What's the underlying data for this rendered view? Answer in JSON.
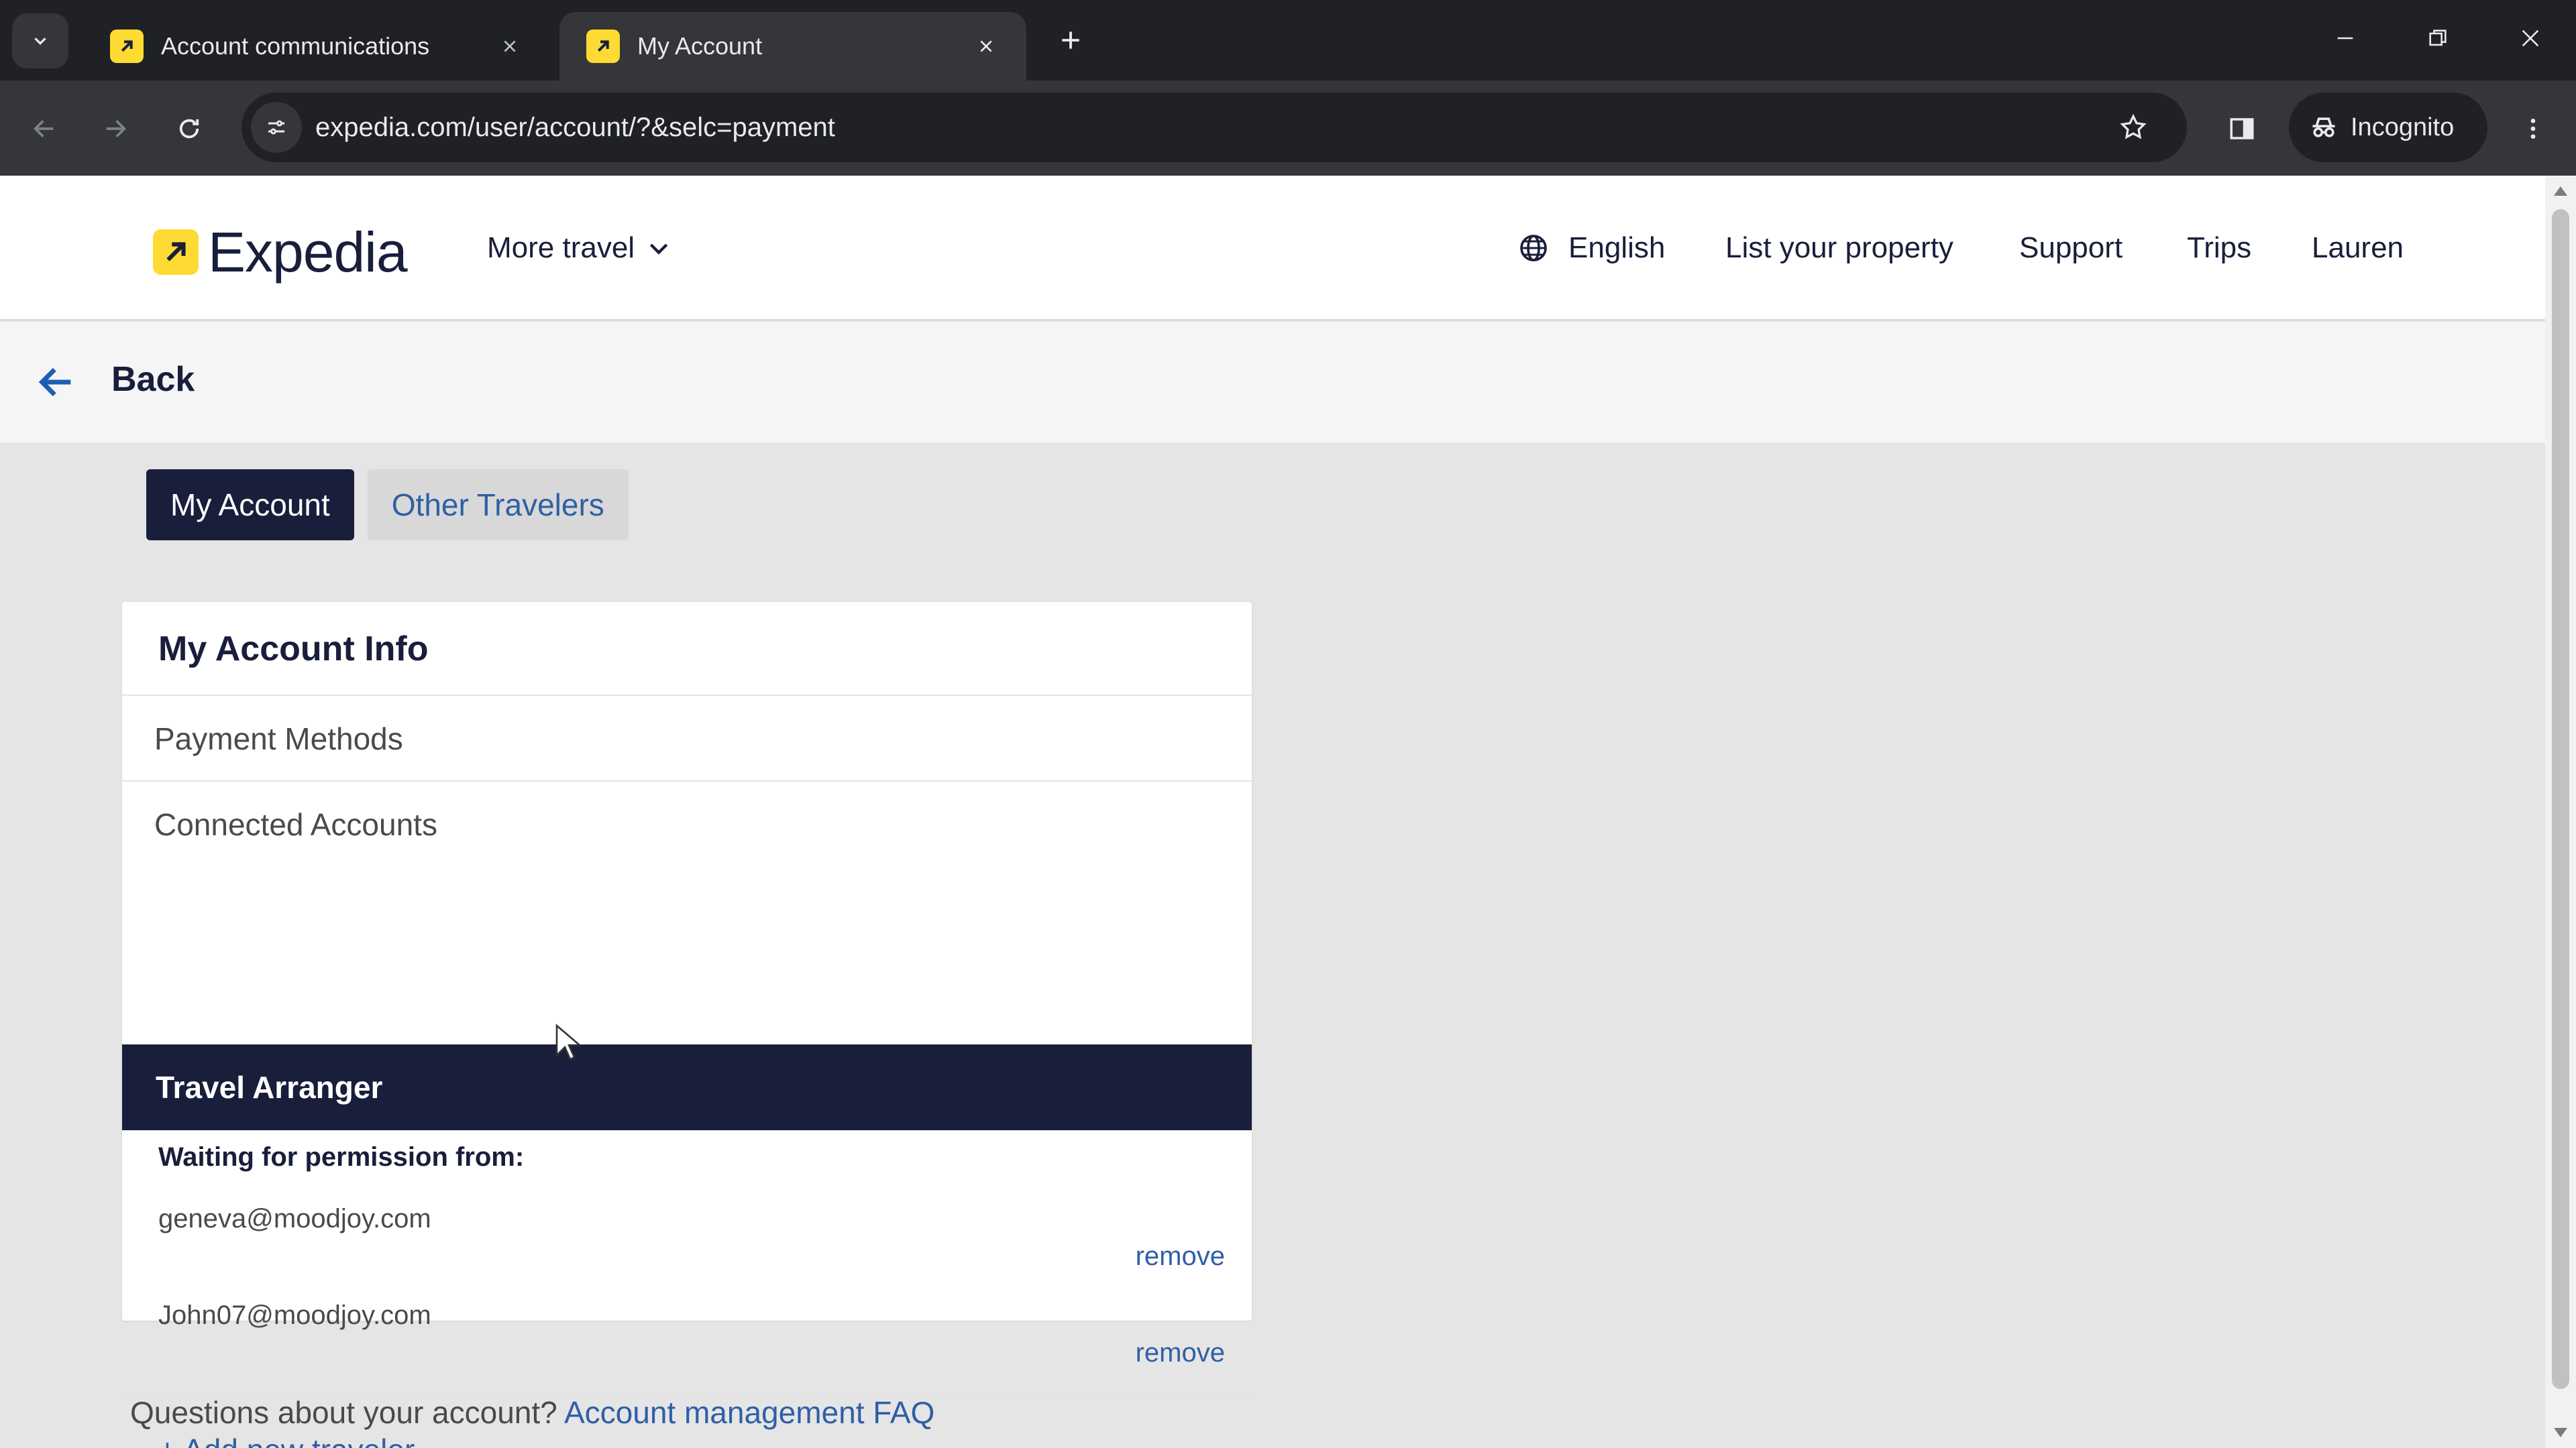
{
  "browser": {
    "tabs": [
      {
        "title": "Account communications",
        "active": false
      },
      {
        "title": "My Account",
        "active": true
      }
    ],
    "url": "expedia.com/user/account/?&selc=payment",
    "incognito_label": "Incognito"
  },
  "header": {
    "brand": "Expedia",
    "more_travel": "More travel",
    "language": "English",
    "list_property": "List your property",
    "support": "Support",
    "trips": "Trips",
    "user": "Lauren"
  },
  "back_label": "Back",
  "account_tabs": {
    "my_account": "My Account",
    "other_travelers": "Other Travelers"
  },
  "card": {
    "title": "My Account Info",
    "payment_methods": "Payment Methods",
    "connected_accounts": "Connected Accounts",
    "travel_arranger": "Travel Arranger",
    "waiting_label": "Waiting for permission from:",
    "pending": [
      {
        "email": "geneva@moodjoy.com",
        "action": "remove"
      },
      {
        "email": "John07@moodjoy.com",
        "action": "remove"
      }
    ],
    "add_traveler": "+ Add new traveler"
  },
  "faq": {
    "question": "Questions about your account?",
    "link": "Account management FAQ"
  },
  "colors": {
    "brand_navy": "#191e3b",
    "brand_yellow": "#fddb32",
    "link_blue": "#2f5fa6"
  }
}
